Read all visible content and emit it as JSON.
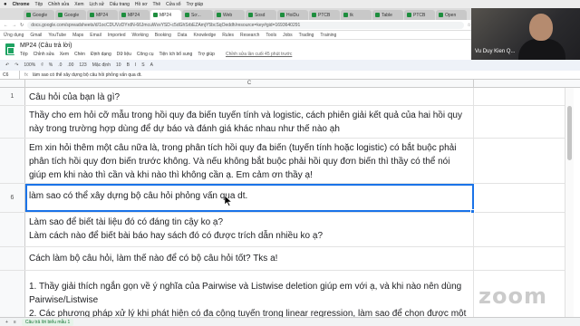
{
  "os_menubar": {
    "app": "Chrome",
    "items": [
      "Tệp",
      "Chỉnh sửa",
      "Xem",
      "Lịch sử",
      "Dấu trang",
      "Hồ sơ",
      "Thẻ",
      "Cửa sổ",
      "Trợ giúp"
    ]
  },
  "browser": {
    "tabs": [
      {
        "label": "Google"
      },
      {
        "label": "Google"
      },
      {
        "label": "MP24"
      },
      {
        "label": "MP24"
      },
      {
        "label": "MP24"
      },
      {
        "label": "Sơ..."
      },
      {
        "label": "Web"
      },
      {
        "label": "Sosd"
      },
      {
        "label": "HoiDu"
      },
      {
        "label": "PTCB"
      },
      {
        "label": "tk"
      },
      {
        "label": "Table"
      },
      {
        "label": "PTCB"
      },
      {
        "label": "Open"
      }
    ],
    "url": "docs.google.com/spreadsheets/d/1ocCDUVzDYrdN-66JmcuWvxYSD-c5dGhSrbEZAmjY5bcSqOeddh/resource=key#gid=1693640291",
    "bookmarks": [
      "Ứng dụng",
      "Gmail",
      "YouTube",
      "Maps",
      "Email",
      "Imported",
      "Working",
      "Booking",
      "Data",
      "Knowledge",
      "Rules",
      "Research",
      "Tools",
      "Jobs",
      "Trading",
      "Training"
    ]
  },
  "sheet": {
    "title": "MP24 (Câu trả lời)",
    "menu": [
      "Tệp",
      "Chỉnh sửa",
      "Xem",
      "Chèn",
      "Định dạng",
      "Dữ liệu",
      "Công cụ",
      "Tiện ích bổ sung",
      "Trợ giúp"
    ],
    "last_edit": "Chỉnh sửa lần cuối 45 phút trước",
    "toolbar": [
      "↶",
      "↷",
      "100%",
      "₫",
      "%",
      ".0",
      ".00",
      "123",
      "Mặc định",
      "10",
      "B",
      "I",
      "S",
      "A"
    ],
    "cell_ref": "C6",
    "formula_value": "làm sao có thể xây dựng bộ câu hỏi phỏng vấn qua dt.",
    "column_header": "C",
    "rows": [
      {
        "num": "1",
        "text": "Câu hỏi của bạn là gì?"
      },
      {
        "num": "",
        "text": "Thầy cho em hỏi cỡ mẫu trong hồi quy đa biến tuyến tính và logistic, cách phiên giải kết quả của hai hồi quy này trong trường hợp dùng để dự báo và đánh giá khác nhau như thế nào ạh"
      },
      {
        "num": "",
        "text": "Em xin hỏi thêm một câu nữa là, trong phân tích hồi quy đa biến (tuyến tính hoặc logistic) có bắt buộc phải phân tích hồi quy đơn biến trước không. Và nếu không bắt buộc phải hồi quy đơn biến thì thầy có thể nói giúp em khi nào thì cần và khi nào thì không cần ạ. Em cảm ơn thầy ạ!"
      },
      {
        "num": "6",
        "text": "làm sao có thể xây dựng bộ câu hỏi phỏng vấn qua dt."
      },
      {
        "num": "",
        "text": "Làm sao để biết tài liệu đó có đáng tin cậy ko ạ?\nLàm cách nào để biết bài báo hay sách đó có được trích dẫn nhiều ko ạ?"
      },
      {
        "num": "",
        "text": "Cách làm bộ câu hỏi, làm thế nào để có bộ câu hỏi tốt? Tks a!"
      },
      {
        "num": "",
        "text": "1. Thầy giải thích ngắn gọn về ý nghĩa của Pairwise và Listwise deletion giúp em với ạ, và khi nào nên dùng Pairwise/Listwise\n2. Các phương pháp xử lý khi phát hiện có đa cộng tuyến trong linear regression, làm sao để chọn được một"
      }
    ],
    "bottom_bar": {
      "add": "+",
      "list": "≡",
      "active_sheet": "Câu trả lời biểu mẫu 1"
    }
  },
  "video": {
    "participant_name": "Vu Duy Kien Q..."
  },
  "watermark": "zoom",
  "colors": {
    "sheets_green": "#1ea362",
    "selection_blue": "#1a73e8"
  }
}
